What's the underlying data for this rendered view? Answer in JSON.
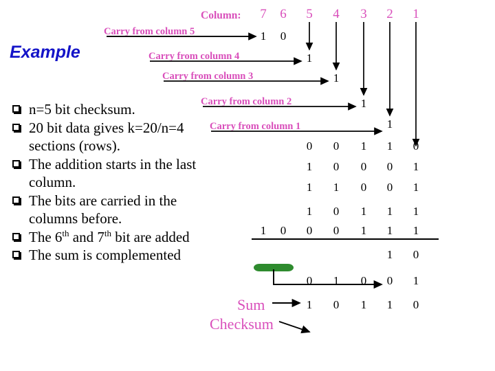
{
  "slide": {
    "title": "Example",
    "title_color": "#1414c8",
    "accent_color": "#d94fbb",
    "highlight_color": "#2e8b2e"
  },
  "bullets": [
    {
      "id": "b1",
      "text": "n=5 bit checksum."
    },
    {
      "id": "b2",
      "text": "20 bit data gives k=20/n=4 sections (rows)."
    },
    {
      "id": "b3",
      "text": "The addition starts in the last column."
    },
    {
      "id": "b4",
      "text": "The bits are carried in the columns before."
    },
    {
      "id": "b5",
      "text": "The 6th and 7th bit are added",
      "has_ordinals": true,
      "parts": [
        "The 6",
        "th",
        " and 7",
        "th",
        " bit are added"
      ]
    },
    {
      "id": "b6",
      "text": "The sum is complemented"
    }
  ],
  "diagram": {
    "column_label": "Column:",
    "column_numbers": [
      "7",
      "6",
      "5",
      "4",
      "3",
      "2",
      "1"
    ],
    "carry_labels": [
      "Carry from column 5",
      "Carry from column 4",
      "Carry from column 3",
      "Carry from column 2",
      "Carry from column 1"
    ],
    "carry_digits": {
      "from_col_5": [
        "1",
        "0"
      ],
      "from_col_4": "1",
      "from_col_3": "1",
      "from_col_2": "1",
      "from_col_1": "1"
    },
    "data_rows": [
      {
        "name": "row-1",
        "bits": [
          "",
          "",
          "0",
          "0",
          "1",
          "1",
          "0"
        ]
      },
      {
        "name": "row-2",
        "bits": [
          "",
          "",
          "1",
          "0",
          "0",
          "0",
          "1"
        ]
      },
      {
        "name": "row-3",
        "bits": [
          "",
          "",
          "1",
          "1",
          "0",
          "0",
          "1"
        ]
      },
      {
        "name": "row-4",
        "bits": [
          "",
          "",
          "1",
          "0",
          "1",
          "1",
          "1"
        ]
      },
      {
        "name": "row-5",
        "bits": [
          "1",
          "0",
          "0",
          "0",
          "1",
          "1",
          "1"
        ]
      }
    ],
    "overflow_bits": [
      "1",
      "0"
    ],
    "wrapped_row": [
      "",
      "",
      "0",
      "1",
      "0",
      "0",
      "1"
    ],
    "sum_row": [
      "",
      "",
      "1",
      "0",
      "1",
      "1",
      "0"
    ],
    "sum_label": "Sum",
    "checksum_label": "Checksum"
  }
}
